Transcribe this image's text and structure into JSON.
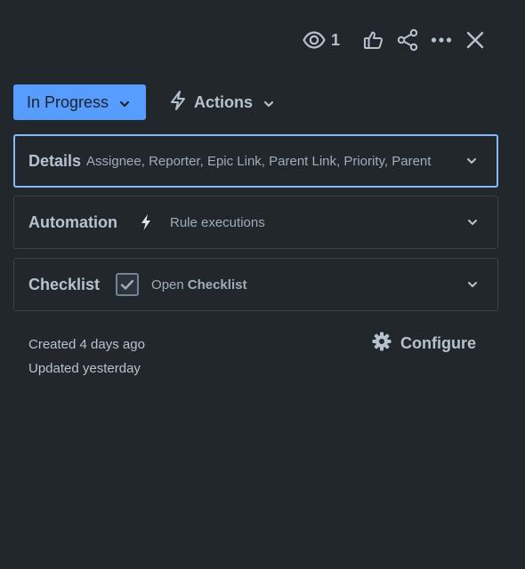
{
  "toolbar": {
    "watchers_count": "1",
    "watch_icon": "eye-icon",
    "like_icon": "thumbs-up-icon",
    "share_icon": "share-icon",
    "more_icon": "more-horizontal-icon",
    "close_icon": "close-icon"
  },
  "status": {
    "label": "In Progress",
    "color": "#579dff"
  },
  "actions": {
    "label": "Actions",
    "icon": "lightning-icon"
  },
  "panels": {
    "details": {
      "title": "Details",
      "summary": "Assignee, Reporter, Epic Link, Parent Link, Priority, Parent"
    },
    "automation": {
      "title": "Automation",
      "summary": "Rule executions",
      "icon": "lightning-icon"
    },
    "checklist": {
      "title": "Checklist",
      "open_label": "Open",
      "name": "Checklist",
      "icon": "checkbox-icon"
    }
  },
  "meta": {
    "created": "Created 4 days ago",
    "updated": "Updated yesterday"
  },
  "configure": {
    "label": "Configure",
    "icon": "gear-icon"
  },
  "colors": {
    "background": "#22272b",
    "accent": "#579dff",
    "focus_border": "#85b8ff",
    "panel_border": "#3b4148",
    "text": "#b6c2cf"
  }
}
